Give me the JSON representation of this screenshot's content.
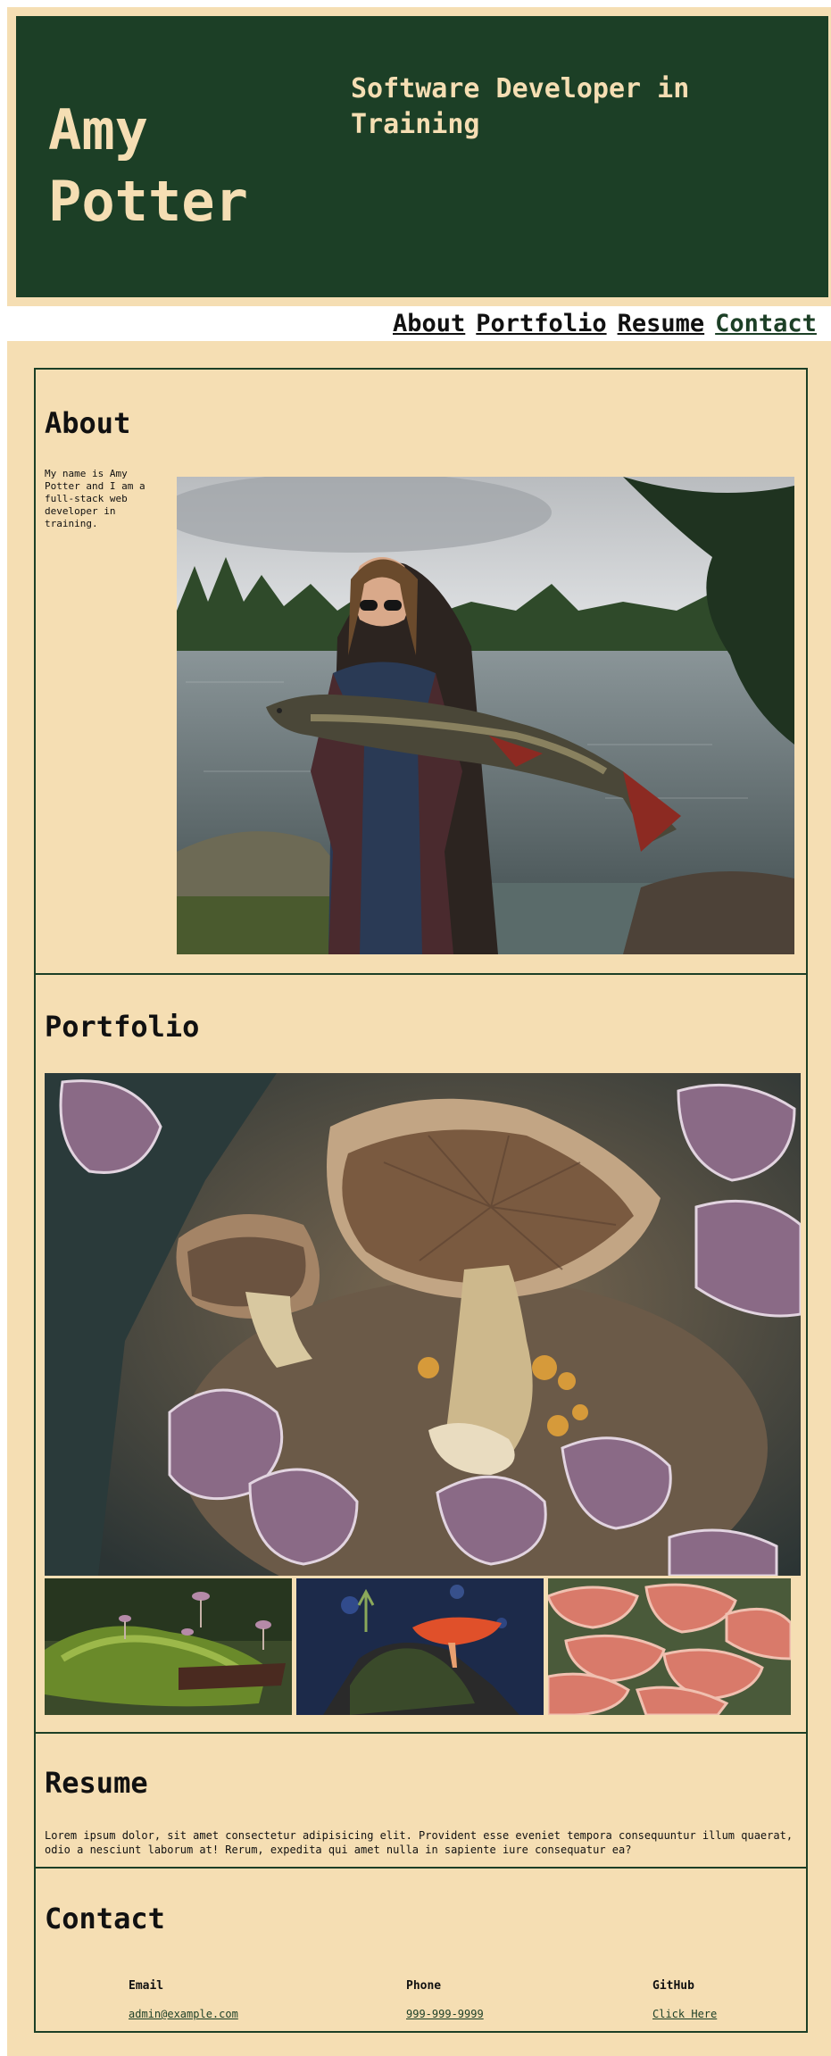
{
  "header": {
    "name": "Amy Potter",
    "subtitle": "Software Developer in Training"
  },
  "nav": {
    "items": [
      "About",
      "Portfolio",
      "Resume",
      "Contact"
    ]
  },
  "about": {
    "heading": "About",
    "text": "My name is Amy Potter and I am a full-stack web developer in training."
  },
  "portfolio": {
    "heading": "Portfolio"
  },
  "resume": {
    "heading": "Resume",
    "text": "Lorem ipsum dolor, sit amet consectetur adipisicing elit. Provident esse eveniet tempora consequuntur illum quaerat, odio a nesciunt laborum at! Rerum, expedita qui amet nulla in sapiente iure consequatur ea?"
  },
  "contact": {
    "heading": "Contact",
    "email_label": "Email",
    "email_value": "admin@example.com",
    "phone_label": "Phone",
    "phone_value": "999-999-9999",
    "github_label": "GitHub",
    "github_value": "Click Here"
  },
  "colors": {
    "header_bg": "#1c3f26",
    "page_bg": "#f5deb3",
    "border": "#1c3f26"
  }
}
